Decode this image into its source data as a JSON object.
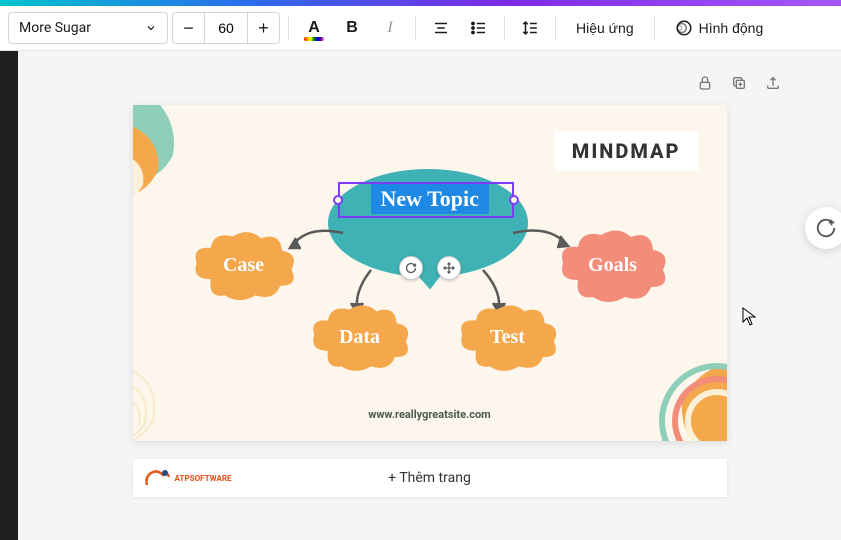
{
  "toolbar": {
    "font_family": "More Sugar",
    "font_size": "60",
    "decrease": "−",
    "increase": "+",
    "effects_label": "Hiệu ứng",
    "animate_label": "Hình động"
  },
  "slide": {
    "title": "MINDMAP",
    "central_topic": "New Topic",
    "nodes": {
      "case": "Case",
      "goals": "Goals",
      "data": "Data",
      "test": "Test"
    },
    "footer_url": "www.reallygreatsite.com"
  },
  "add_page_label": "+ Thêm trang",
  "logo_text": "ATPSOFTWARE",
  "colors": {
    "orange": "#f4a84b",
    "salmon": "#f38d7a",
    "teal": "#3eb2b5",
    "cream": "#fdf6ec"
  }
}
